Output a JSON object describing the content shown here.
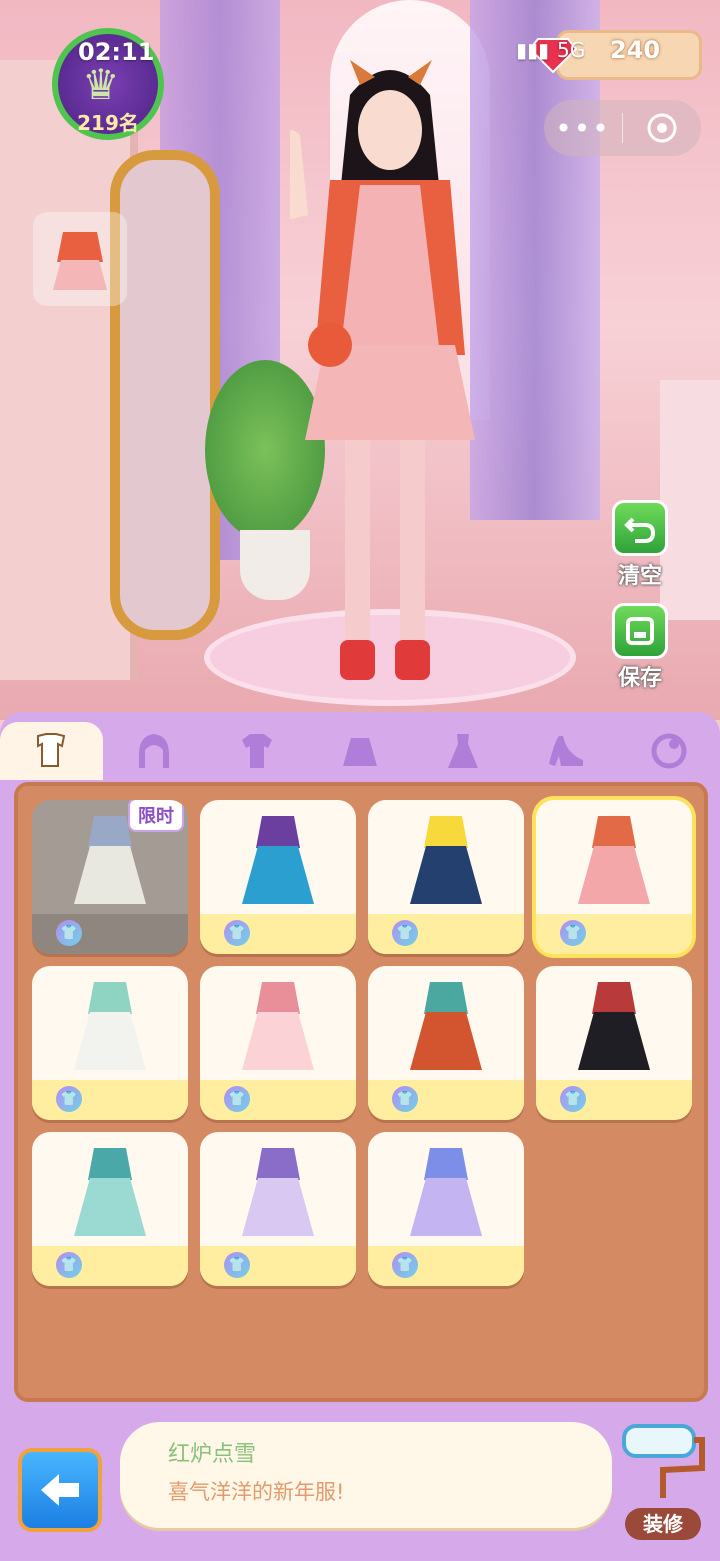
{
  "status_bar": {
    "time": "02:11",
    "network": "5G",
    "mute_icon": "bell-off-icon"
  },
  "player": {
    "rank": "219名"
  },
  "currency": {
    "gems": "240",
    "gem_icon": "diamond-icon"
  },
  "miniprogram": {
    "more_icon": "more-dots-icon",
    "close_icon": "target-icon"
  },
  "actions": {
    "clear_label": "清空",
    "save_label": "保存"
  },
  "tabs": [
    {
      "name": "outfit-set",
      "icon": "outfit-icon",
      "active": true
    },
    {
      "name": "hair",
      "icon": "hair-icon",
      "active": false
    },
    {
      "name": "top",
      "icon": "shirt-icon",
      "active": false
    },
    {
      "name": "skirt",
      "icon": "skirt-icon",
      "active": false
    },
    {
      "name": "dress",
      "icon": "dress-icon",
      "active": false
    },
    {
      "name": "shoes",
      "icon": "high-heel-icon",
      "active": false
    },
    {
      "name": "accessory",
      "icon": "accessory-icon",
      "active": false
    }
  ],
  "items": [
    {
      "badge": "限时",
      "color": "#e8e8e0",
      "accent": "#9aa8c8",
      "state": "dim"
    },
    {
      "badge": "",
      "color": "#2b9fd0",
      "accent": "#6b3fa0",
      "state": "normal"
    },
    {
      "badge": "",
      "color": "#24406e",
      "accent": "#f7d93b",
      "state": "normal"
    },
    {
      "badge": "",
      "color": "#f3a7a8",
      "accent": "#e36a46",
      "state": "selected"
    },
    {
      "badge": "",
      "color": "#f2f3ee",
      "accent": "#8fd3c2",
      "state": "normal"
    },
    {
      "badge": "",
      "color": "#fbd3d6",
      "accent": "#e88f9a",
      "state": "normal"
    },
    {
      "badge": "",
      "color": "#d2552f",
      "accent": "#4aa8a0",
      "state": "normal"
    },
    {
      "badge": "",
      "color": "#1e1e24",
      "accent": "#b83a3a",
      "state": "normal"
    },
    {
      "badge": "",
      "color": "#9bd9d3",
      "accent": "#4aa8a8",
      "state": "normal"
    },
    {
      "badge": "",
      "color": "#d8c8f2",
      "accent": "#8a6cc9",
      "state": "normal"
    },
    {
      "badge": "",
      "color": "#c5b4f2",
      "accent": "#7d8ee8",
      "state": "normal"
    }
  ],
  "description": {
    "title": "红炉点雪",
    "text": "喜气洋洋的新年服!"
  },
  "bottom": {
    "dress_up_label": "装修"
  }
}
